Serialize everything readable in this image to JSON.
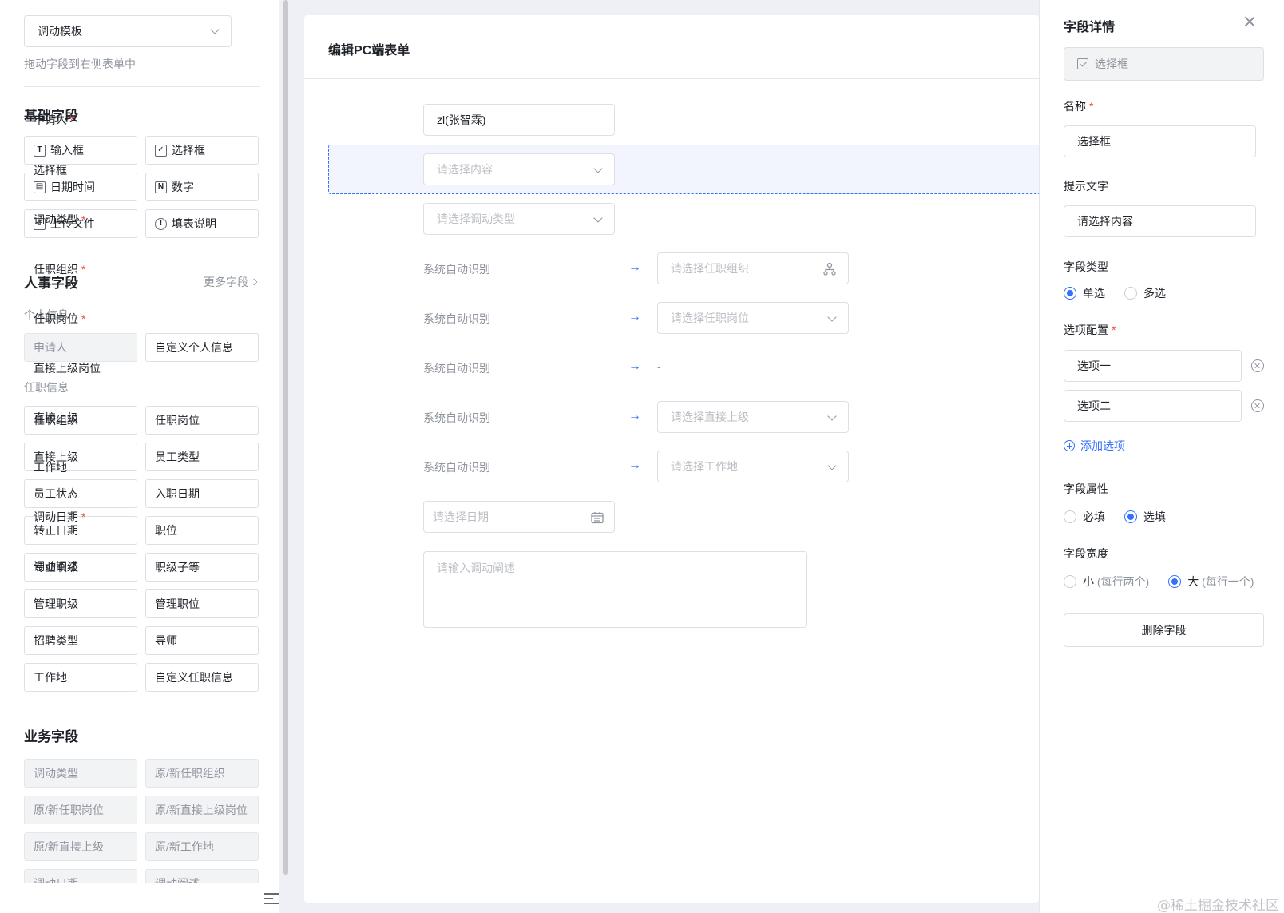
{
  "left": {
    "template": "调动模板",
    "hint": "拖动字段到右侧表单中",
    "basic_title": "基础字段",
    "basic_fields": [
      {
        "label": "输入框",
        "icon": "T"
      },
      {
        "label": "选择框",
        "icon": "✓"
      },
      {
        "label": "日期时间",
        "icon": "▤"
      },
      {
        "label": "数字",
        "icon": "N"
      },
      {
        "label": "上传文件",
        "icon": "⇧"
      },
      {
        "label": "填表说明",
        "icon": "!"
      }
    ],
    "hr_title": "人事字段",
    "more_fields": "更多字段",
    "personal_title": "个人信息",
    "personal_fields": [
      "申请人",
      "自定义个人信息"
    ],
    "job_title": "任职信息",
    "job_fields": [
      "任职组织",
      "任职岗位",
      "直接上级",
      "员工类型",
      "员工状态",
      "入职日期",
      "转正日期",
      "职位",
      "专业职级",
      "职级子等",
      "管理职级",
      "管理职位",
      "招聘类型",
      "导师",
      "工作地",
      "自定义任职信息"
    ],
    "biz_title": "业务字段",
    "biz_fields": [
      "调动类型",
      "原/新任职组织",
      "原/新任职岗位",
      "原/新直接上级岗位",
      "原/新直接上级",
      "原/新工作地",
      "调动日期",
      "调动阐述"
    ]
  },
  "form": {
    "title": "编辑PC端表单",
    "required_mark": "*",
    "auto_text": "系统自动识别",
    "dash": "-",
    "arrow": "→",
    "rows": {
      "applicant": {
        "label": "申请人",
        "value": "zl(张智霖)"
      },
      "select": {
        "label": "选择框",
        "placeholder": "请选择内容"
      },
      "transfer_type": {
        "label": "调动类型",
        "placeholder": "请选择调动类型"
      },
      "org": {
        "label": "任职组织",
        "placeholder": "请选择任职组织"
      },
      "post": {
        "label": "任职岗位",
        "placeholder": "请选择任职岗位"
      },
      "superior_post": {
        "label": "直接上级岗位"
      },
      "superior": {
        "label": "直接上级",
        "placeholder": "请选择直接上级"
      },
      "workplace": {
        "label": "工作地",
        "placeholder": "请选择工作地"
      },
      "date": {
        "label": "调动日期",
        "placeholder": "请选择日期"
      },
      "desc": {
        "label": "调动阐述",
        "placeholder": "请输入调动阐述"
      }
    }
  },
  "detail": {
    "title": "字段详情",
    "type_label": "选择框",
    "name_label": "名称",
    "name_value": "选择框",
    "hint_label": "提示文字",
    "hint_value": "请选择内容",
    "field_type_label": "字段类型",
    "single": "单选",
    "multi": "多选",
    "options_label": "选项配置",
    "options": [
      "选项一",
      "选项二"
    ],
    "add_option": "添加选项",
    "attr_label": "字段属性",
    "required": "必填",
    "optional": "选填",
    "width_label": "字段宽度",
    "small": "小",
    "small_note": "(每行两个)",
    "large": "大",
    "large_note": "(每行一个)",
    "delete": "删除字段"
  },
  "watermark": "@稀土掘金技术社区",
  "colors": {
    "accent": "#3370ff",
    "required": "#f54a45"
  }
}
